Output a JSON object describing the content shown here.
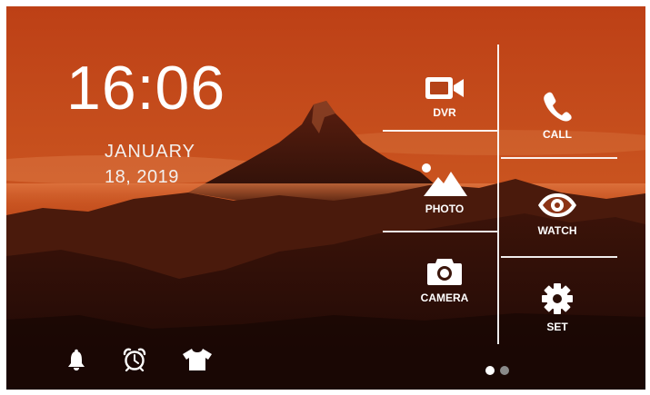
{
  "clock": {
    "time": "16:06"
  },
  "date": {
    "month": "JANUARY",
    "day_year": "18, 2019"
  },
  "tiles": {
    "dvr": {
      "label": "DVR",
      "icon": "video-camera-icon"
    },
    "call": {
      "label": "CALL",
      "icon": "phone-icon"
    },
    "photo": {
      "label": "PHOTO",
      "icon": "mountain-photo-icon"
    },
    "watch": {
      "label": "WATCH",
      "icon": "eye-icon"
    },
    "camera": {
      "label": "CAMERA",
      "icon": "camera-icon"
    },
    "set": {
      "label": "SET",
      "icon": "gear-icon"
    }
  },
  "dock": [
    {
      "icon": "bell-icon"
    },
    {
      "icon": "alarm-clock-icon"
    },
    {
      "icon": "tshirt-icon"
    }
  ],
  "pager": {
    "total": 2,
    "active": 1
  },
  "colors": {
    "sky": "#c1441a",
    "mountain": "#2e120b",
    "text": "#ffffff",
    "inactive_dot": "#8a8a8a"
  }
}
